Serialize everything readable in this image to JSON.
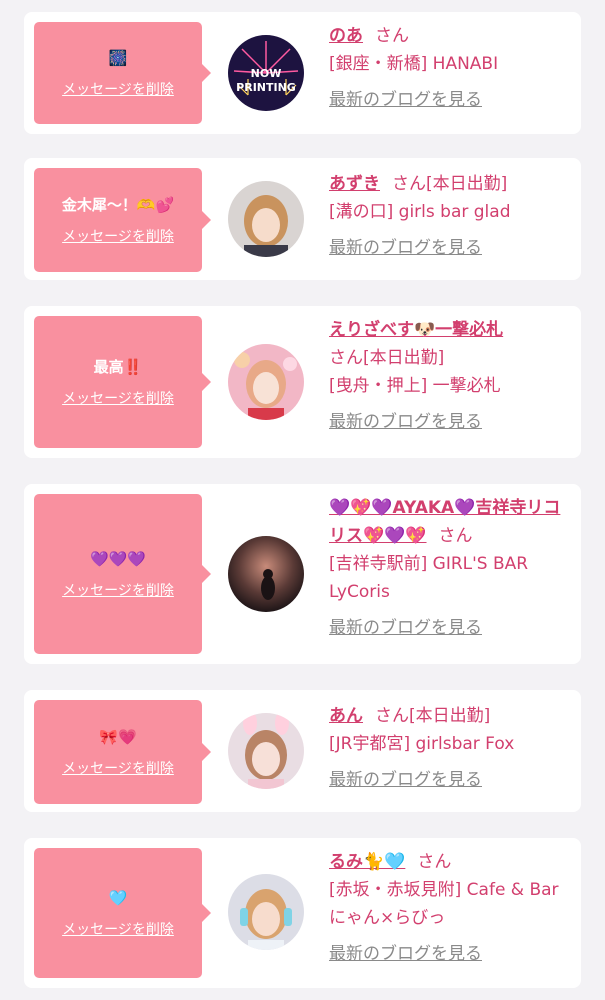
{
  "delete_label": "メッセージを削除",
  "honorific": "さん",
  "blog_label": "最新のブログを見る",
  "colors": {
    "bubble": "#f9909f",
    "accent": "#d23f6e",
    "link_gray": "#8a8a8a",
    "card": "#ffffff",
    "page_bg": "#f3f2f5"
  },
  "entries": [
    {
      "message": "🎆",
      "name": "のあ",
      "status": "",
      "shop": "[銀座・新橋] HANABI",
      "avatar_text": "NOW PRINTING"
    },
    {
      "message": "金木犀〜！🫶💕",
      "name": "あずき",
      "status": "[本日出勤]",
      "shop": "[溝の口] girls bar glad"
    },
    {
      "message": "最高‼️",
      "name": "えりざべす🐶一撃必札",
      "status": "[本日出勤]",
      "shop": "[曳舟・押上] 一撃必札"
    },
    {
      "message": "💜💜💜",
      "name": "💜💖💜AYAKA💜吉祥寺リコリス💖💜💖",
      "status": "",
      "shop": "[吉祥寺駅前] GIRL'S BAR LyCoris"
    },
    {
      "message": "🎀💗",
      "name": "あん",
      "status": "[本日出勤]",
      "shop": "[JR宇都宮] girlsbar Fox"
    },
    {
      "message": "🩵",
      "name": "るみ🐈🩵",
      "status": "",
      "shop": "[赤坂・赤坂見附] Cafe & Bar にゃん×らびっ"
    }
  ]
}
